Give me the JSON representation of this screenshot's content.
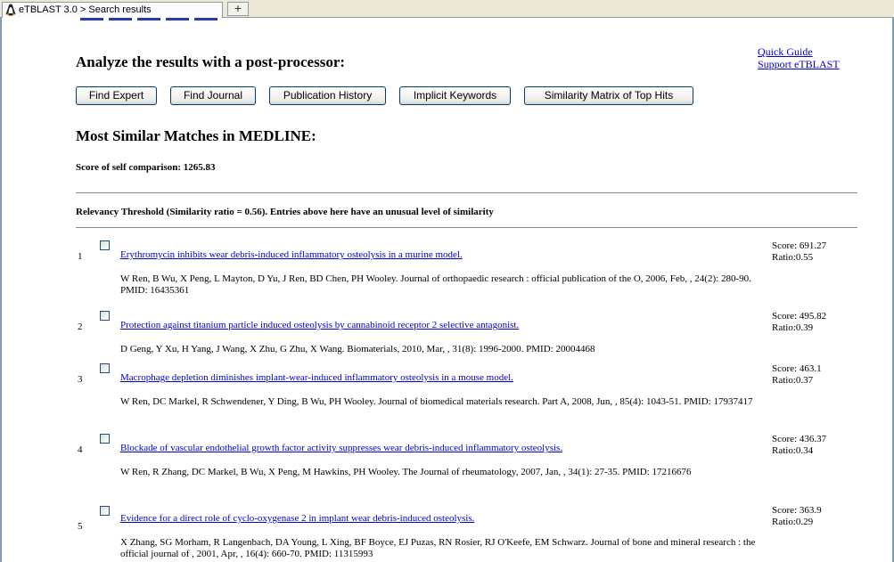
{
  "browser": {
    "tab_title": "eTBLAST 3.0 > Search results",
    "new_tab_label": "+"
  },
  "side_links": {
    "quick_guide": "Quick Guide",
    "support": "Support eTBLAST"
  },
  "postprocessor": {
    "heading": "Analyze the results with a post-processor:",
    "buttons": [
      "Find Expert",
      "Find Journal",
      "Publication History",
      "Implicit Keywords",
      "Similarity Matrix of Top Hits"
    ]
  },
  "matches": {
    "heading": "Most Similar Matches in MEDLINE:",
    "self_score": "Score of self comparison: 1265.83",
    "threshold": "Relevancy Threshold (Similarity ratio = 0.56). Entries above here have an unusual level of similarity"
  },
  "results": [
    {
      "num": "1",
      "title": "Erythromycin inhibits wear debris-induced inflammatory osteolysis in a murine model.",
      "citation": "W Ren, B Wu, X Peng, L Mayton, D Yu, J Ren, BD Chen, PH Wooley. Journal of orthopaedic research : official publication of the O, 2006, Feb, , 24(2): 280-90.   PMID: 16435361",
      "score": "Score: 691.27",
      "ratio": "Ratio:0.55"
    },
    {
      "num": "2",
      "title": "Protection against titanium particle induced osteolysis by cannabinoid receptor 2 selective antagonist.",
      "citation": "D Geng, Y Xu, H Yang, J Wang, X Zhu, G Zhu, X Wang. Biomaterials, 2010, Mar, , 31(8): 1996-2000.   PMID: 20004468",
      "score": "Score: 495.82",
      "ratio": "Ratio:0.39"
    },
    {
      "num": "3",
      "title": "Macrophage depletion diminishes implant-wear-induced inflammatory osteolysis in a mouse model.",
      "citation": "W Ren, DC Markel, R Schwendener, Y Ding, B Wu, PH Wooley. Journal of biomedical materials research. Part A, 2008, Jun, , 85(4): 1043-51.   PMID: 17937417",
      "score": "Score: 463.1",
      "ratio": "Ratio:0.37"
    },
    {
      "num": "4",
      "title": "Blockade of vascular endothelial growth factor activity suppresses wear debris-induced inflammatory osteolysis.",
      "citation": "W Ren, R Zhang, DC Markel, B Wu, X Peng, M Hawkins, PH Wooley. The Journal of rheumatology, 2007, Jan, , 34(1): 27-35.   PMID: 17216676",
      "score": "Score: 436.37",
      "ratio": "Ratio:0.34"
    },
    {
      "num": "5",
      "title": "Evidence for a direct role of cyclo-oxygenase 2 in implant wear debris-induced osteolysis.",
      "citation": "X Zhang, SG Morham, R Langenbach, DA Young, L Xing, BF Boyce, EJ Puzas, RN Rosier, RJ O'Keefe, EM Schwarz. Journal of bone and mineral research : the official journal of , 2001, Apr, , 16(4): 660-70.   PMID: 11315993",
      "score": "Score: 363.9",
      "ratio": "Ratio:0.29"
    }
  ]
}
